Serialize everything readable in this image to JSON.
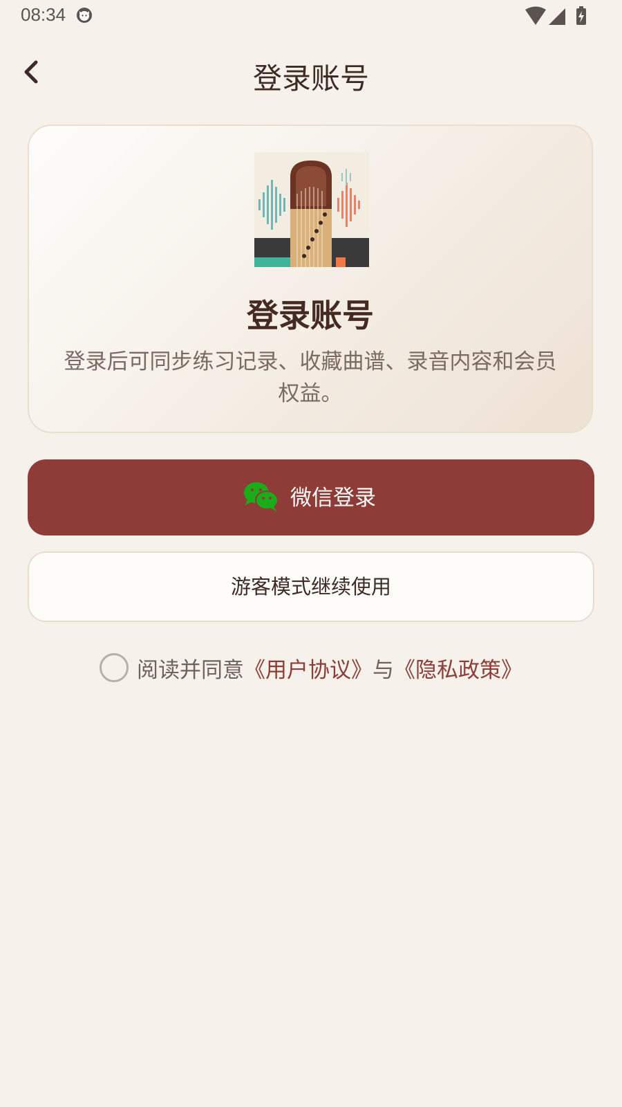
{
  "status_bar": {
    "time": "08:34"
  },
  "nav": {
    "title": "登录账号"
  },
  "card": {
    "title": "登录账号",
    "description": "登录后可同步练习记录、收藏曲谱、录音内容和会员权益。"
  },
  "wechat_button": {
    "label": "微信登录"
  },
  "guest_button": {
    "label": "游客模式继续使用"
  },
  "agreement": {
    "prefix": "阅读并同意",
    "user_agreement": "《用户协议》",
    "connector": "与",
    "privacy_policy": "《隐私政策》"
  },
  "colors": {
    "background": "#f6f1ea",
    "primary": "#8e3c37",
    "wechat_green": "#1aad19",
    "title": "#3d2b24"
  },
  "icons": [
    "cat-icon",
    "wifi-icon",
    "signal-icon",
    "battery-charging-icon",
    "back-arrow-icon",
    "guzheng-app-icon",
    "wechat-icon"
  ]
}
